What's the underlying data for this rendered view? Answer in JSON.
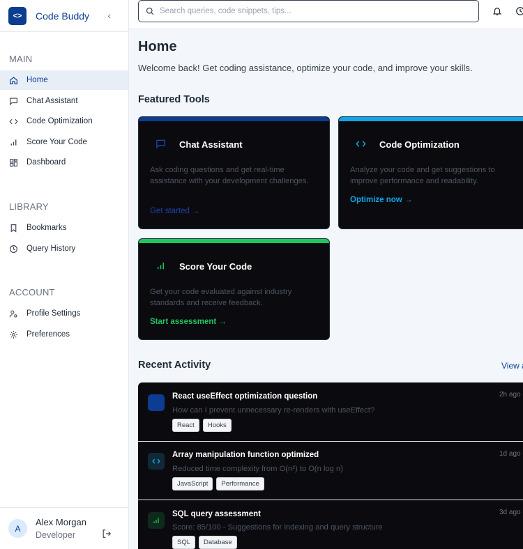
{
  "app": {
    "name": "Code Buddy",
    "logo_glyph": "<>",
    "accent": "#0b3d91"
  },
  "sidebar": {
    "collapse_glyph": "‹",
    "sections": [
      {
        "title": "MAIN",
        "items": [
          {
            "label": "Home",
            "icon": "home-icon",
            "active": true
          },
          {
            "label": "Chat Assistant",
            "icon": "chat-icon"
          },
          {
            "label": "Code Optimization",
            "icon": "code-icon"
          },
          {
            "label": "Score Your Code",
            "icon": "bar-chart-icon"
          },
          {
            "label": "Dashboard",
            "icon": "dashboard-icon"
          }
        ]
      },
      {
        "title": "LIBRARY",
        "items": [
          {
            "label": "Bookmarks",
            "icon": "bookmark-icon"
          },
          {
            "label": "Query History",
            "icon": "clock-icon"
          }
        ]
      },
      {
        "title": "ACCOUNT",
        "items": [
          {
            "label": "Profile Settings",
            "icon": "user-settings-icon"
          },
          {
            "label": "Preferences",
            "icon": "gear-icon"
          }
        ]
      }
    ],
    "user": {
      "initial": "A",
      "name": "Alex Morgan",
      "role": "Developer"
    }
  },
  "topbar": {
    "search_placeholder": "Search queries, code snippets, tips..."
  },
  "main": {
    "title": "Home",
    "subtitle": "Welcome back! Get coding assistance, optimize your code, and improve your skills.",
    "featured_title": "Featured Tools",
    "cards": [
      {
        "title": "Chat Assistant",
        "desc": "Ask coding questions and get real-time assistance with your development challenges.",
        "link": "Get started →",
        "color": "#0b3d91",
        "link_color": "#1e40af",
        "icon": "chat-icon"
      },
      {
        "title": "Code Optimization",
        "desc": "Analyze your code and get suggestions to improve performance and readability.",
        "link": "Optimize now →",
        "color": "#0ea5e9",
        "link_color": "#0ea5e9",
        "icon": "code-icon"
      },
      {
        "title": "Score Your Code",
        "desc": "Get your code evaluated against industry standards and receive feedback.",
        "link": "Start assessment →",
        "color": "#22c55e",
        "link_color": "#22c55e",
        "icon": "bar-chart-icon"
      }
    ],
    "recent_title": "Recent Activity",
    "view_all": "View all",
    "activities": [
      {
        "title": "React useEffect optimization question",
        "desc": "How can I prevent unnecessary re-renders with useEffect?",
        "time": "2h ago",
        "tags": [
          "React",
          "Hooks"
        ],
        "icon": "chat-icon",
        "icon_bg": "#0b3d91"
      },
      {
        "title": "Array manipulation function optimized",
        "desc": "Reduced time complexity from O(n²) to O(n log n)",
        "time": "1d ago",
        "tags": [
          "JavaScript",
          "Performance"
        ],
        "icon": "code-icon",
        "icon_bg": "#0f2a36"
      },
      {
        "title": "SQL query assessment",
        "desc": "Score: 85/100 - Suggestions for indexing and query structure",
        "time": "3d ago",
        "tags": [
          "SQL",
          "Database"
        ],
        "icon": "bar-chart-icon",
        "icon_bg": "#0f2a1a"
      }
    ]
  }
}
